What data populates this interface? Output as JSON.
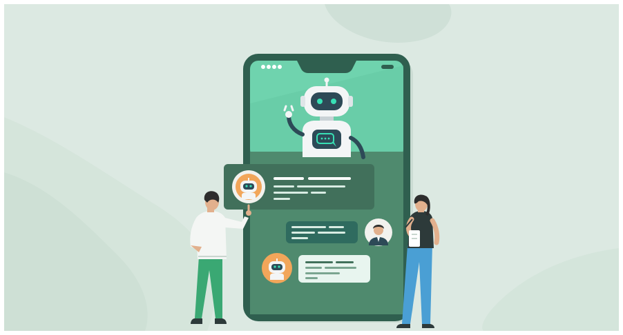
{
  "scene": {
    "description_colors": {
      "background": "#dce9e2",
      "phone_frame": "#2f5f4f",
      "phone_screen_top": "#6fd3ae",
      "phone_screen_bottom": "#4f8a6e",
      "bubble_dark": "#41705b",
      "bubble_teal": "#2f6b5f",
      "bubble_light": "#e8f5ef",
      "robot_white": "#f3f5f6",
      "robot_dark": "#2d4a57",
      "robot_eye": "#38e0b5",
      "avatar_orange": "#f2a65a"
    },
    "icons": [
      "robot-icon",
      "chat-bubble-icon",
      "user-avatar-icon",
      "bot-avatar-icon"
    ]
  }
}
